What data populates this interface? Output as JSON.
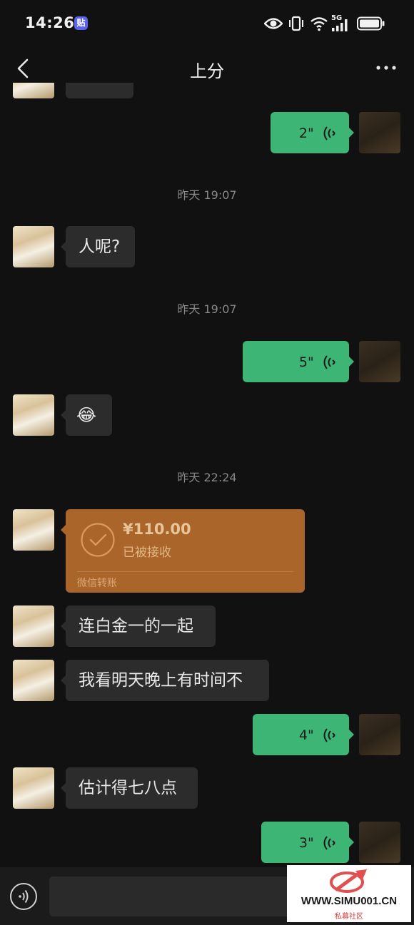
{
  "status_bar": {
    "time": "14:26",
    "badge": "贴",
    "network": "5G"
  },
  "nav": {
    "title": "上分"
  },
  "messages": [
    {
      "type": "timestamp",
      "text": "昨天 19:07"
    },
    {
      "type": "text",
      "side": "in",
      "text": "人呢?"
    },
    {
      "type": "timestamp",
      "text": "昨天 19:07"
    },
    {
      "type": "voice",
      "side": "out",
      "duration": "5\""
    },
    {
      "type": "emoji",
      "side": "in",
      "emoji": "😂"
    },
    {
      "type": "timestamp",
      "text": "昨天 22:24"
    },
    {
      "type": "transfer",
      "side": "in",
      "amount": "¥110.00",
      "status": "已被接收",
      "label": "微信转账"
    },
    {
      "type": "text",
      "side": "in",
      "text": "连白金一的一起"
    },
    {
      "type": "text",
      "side": "in",
      "text": "我看明天晚上有时间不"
    },
    {
      "type": "voice",
      "side": "out",
      "duration": "4\""
    },
    {
      "type": "text",
      "side": "in",
      "text": "估计得七八点"
    },
    {
      "type": "voice",
      "side": "out",
      "duration": "3\""
    }
  ],
  "top_voice": {
    "duration": "2\""
  },
  "watermark": {
    "text": "WWW.SIMU001.CN",
    "sub": "私募社区"
  },
  "colors": {
    "background": "#111111",
    "bubble_out": "#3db575",
    "bubble_in": "#2c2c2c",
    "transfer": "#a9652a"
  }
}
